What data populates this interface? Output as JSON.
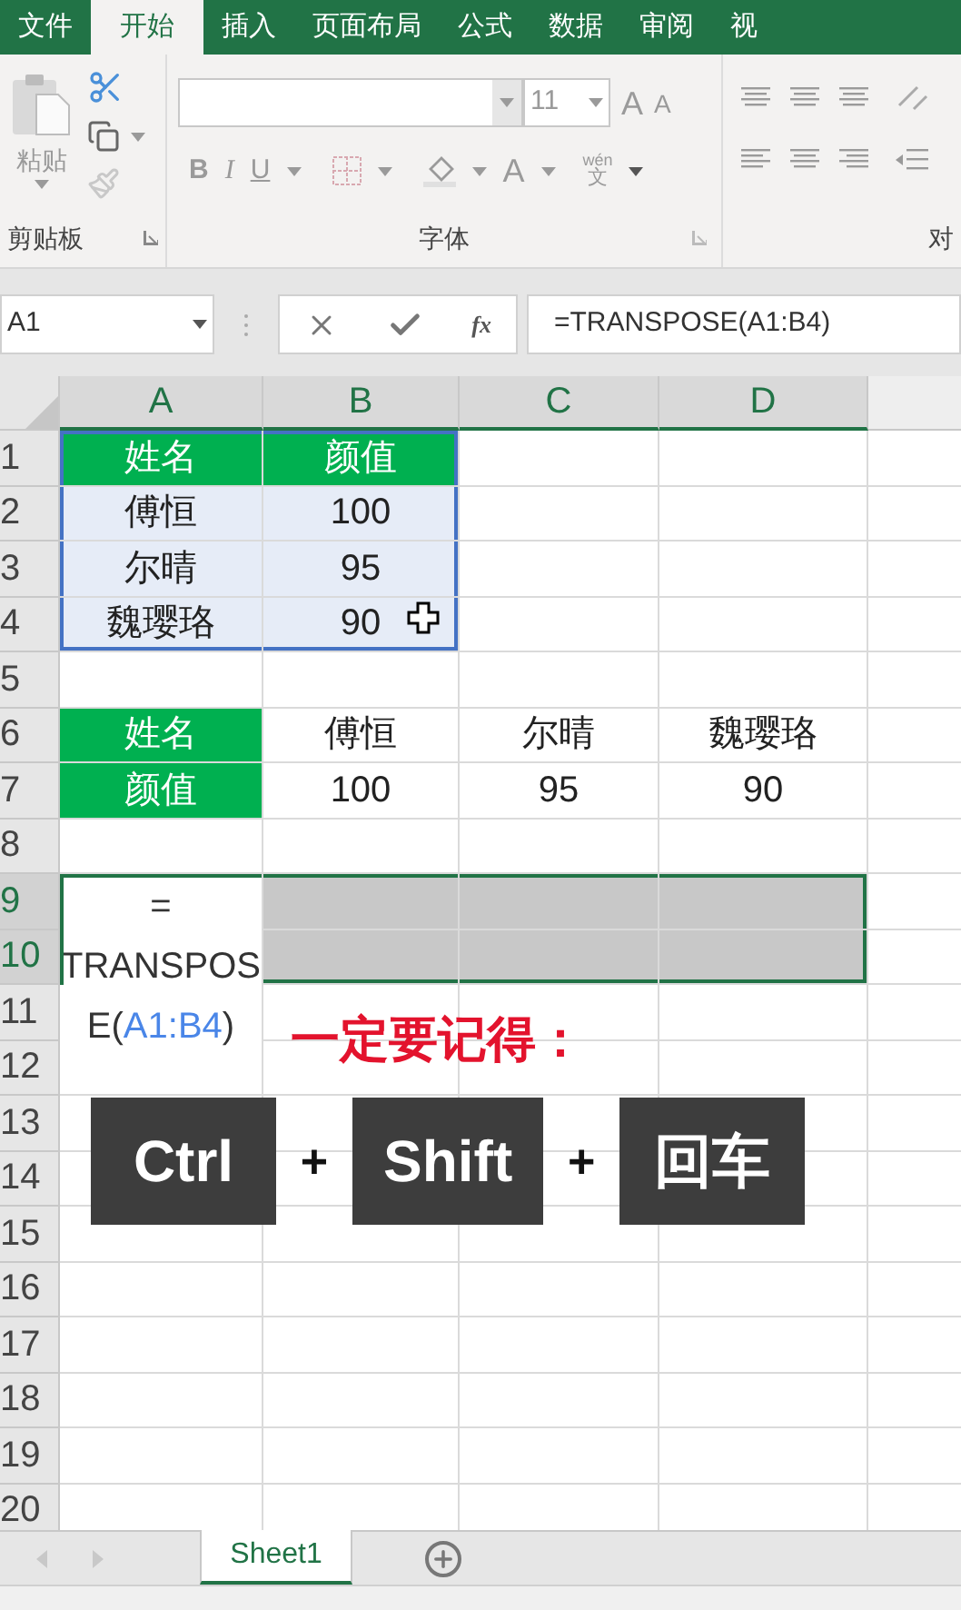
{
  "ribbon_tabs": [
    {
      "label": "文件",
      "selected": false
    },
    {
      "label": "开始",
      "selected": true
    },
    {
      "label": "插入",
      "selected": false
    },
    {
      "label": "页面布局",
      "selected": false
    },
    {
      "label": "公式",
      "selected": false
    },
    {
      "label": "数据",
      "selected": false
    },
    {
      "label": "审阅",
      "selected": false
    },
    {
      "label": "视",
      "selected": false
    }
  ],
  "ribbon": {
    "paste_label": "粘贴",
    "font_size": "11",
    "grow_font": "A",
    "shrink_font": "A",
    "bold": "B",
    "italic": "I",
    "underline": "U",
    "font_color": "A",
    "phonetic_top": "wén",
    "phonetic_bottom": "文",
    "group_labels": [
      "剪贴板",
      "字体",
      "对"
    ]
  },
  "formula_bar": {
    "name_box": "A1",
    "function_label": "fx",
    "formula": "=TRANSPOSE(A1:B4)"
  },
  "columns": [
    "A",
    "B",
    "C",
    "D"
  ],
  "rows": [
    {
      "number": "1",
      "cells": [
        {
          "kind": "header",
          "text": "姓名",
          "selected": false,
          "referenced": true
        },
        {
          "kind": "header",
          "text": "颜值",
          "selected": false,
          "referenced": true
        },
        {
          "kind": "blank",
          "selected": false,
          "referenced": false
        },
        {
          "kind": "blank",
          "selected": false,
          "referenced": false
        }
      ]
    },
    {
      "number": "2",
      "cells": [
        {
          "kind": "text",
          "text": "傅恒",
          "selected": false,
          "referenced": true
        },
        {
          "kind": "text",
          "text": "100",
          "selected": false,
          "referenced": true
        },
        {
          "kind": "blank",
          "selected": false,
          "referenced": false
        },
        {
          "kind": "blank",
          "selected": false,
          "referenced": false
        }
      ]
    },
    {
      "number": "3",
      "cells": [
        {
          "kind": "text",
          "text": "尔晴",
          "selected": false,
          "referenced": true
        },
        {
          "kind": "text",
          "text": "95",
          "selected": false,
          "referenced": true
        },
        {
          "kind": "blank",
          "selected": false,
          "referenced": false
        },
        {
          "kind": "blank",
          "selected": false,
          "referenced": false
        }
      ]
    },
    {
      "number": "4",
      "cells": [
        {
          "kind": "text",
          "text": "魏璎珞",
          "selected": false,
          "referenced": true
        },
        {
          "kind": "text",
          "text": "90",
          "selected": false,
          "referenced": true
        },
        {
          "kind": "blank",
          "selected": false,
          "referenced": false
        },
        {
          "kind": "blank",
          "selected": false,
          "referenced": false
        }
      ]
    },
    {
      "number": "5",
      "cells": [
        {
          "kind": "blank",
          "selected": false,
          "referenced": false
        },
        {
          "kind": "blank",
          "selected": false,
          "referenced": false
        },
        {
          "kind": "blank",
          "selected": false,
          "referenced": false
        },
        {
          "kind": "blank",
          "selected": false,
          "referenced": false
        }
      ]
    },
    {
      "number": "6",
      "cells": [
        {
          "kind": "header",
          "text": "姓名",
          "selected": false,
          "referenced": false
        },
        {
          "kind": "text",
          "text": "傅恒",
          "selected": false,
          "referenced": false
        },
        {
          "kind": "text",
          "text": "尔晴",
          "selected": false,
          "referenced": false
        },
        {
          "kind": "text",
          "text": "魏璎珞",
          "selected": false,
          "referenced": false
        }
      ]
    },
    {
      "number": "7",
      "cells": [
        {
          "kind": "header",
          "text": "颜值",
          "selected": false,
          "referenced": false
        },
        {
          "kind": "text",
          "text": "100",
          "selected": false,
          "referenced": false
        },
        {
          "kind": "text",
          "text": "95",
          "selected": false,
          "referenced": false
        },
        {
          "kind": "text",
          "text": "90",
          "selected": false,
          "referenced": false
        }
      ]
    },
    {
      "number": "8",
      "cells": [
        {
          "kind": "blank",
          "selected": false,
          "referenced": false
        },
        {
          "kind": "blank",
          "selected": false,
          "referenced": false
        },
        {
          "kind": "blank",
          "selected": false,
          "referenced": false
        },
        {
          "kind": "blank",
          "selected": false,
          "referenced": false
        }
      ]
    },
    {
      "number": "9",
      "cells": [
        {
          "kind": "formula",
          "lines": [
            [
              {
                "text": "="
              }
            ],
            [
              {
                "text": "TRANSPOS"
              }
            ],
            [
              {
                "text": "E("
              },
              {
                "text": "A1:B4",
                "kind": "ref"
              },
              {
                "text": ")"
              }
            ]
          ],
          "selected": true,
          "referenced": false
        },
        {
          "kind": "blank",
          "selected": true,
          "referenced": false
        },
        {
          "kind": "blank",
          "selected": true,
          "referenced": false
        },
        {
          "kind": "blank",
          "selected": true,
          "referenced": false
        }
      ]
    },
    {
      "number": "10",
      "cells": [
        {
          "kind": "blank",
          "selected": true,
          "referenced": false
        },
        {
          "kind": "blank",
          "selected": true,
          "referenced": false
        },
        {
          "kind": "blank",
          "selected": true,
          "referenced": false
        }
      ]
    },
    {
      "number": "11",
      "cells": [
        {
          "kind": "blank",
          "selected": false,
          "referenced": false
        },
        {
          "kind": "blank",
          "selected": false,
          "referenced": false
        },
        {
          "kind": "blank",
          "selected": false,
          "referenced": false
        }
      ]
    },
    {
      "number": "12",
      "cells": [
        {
          "kind": "blank",
          "selected": false,
          "referenced": false
        },
        {
          "kind": "blank",
          "selected": false,
          "referenced": false
        },
        {
          "kind": "blank",
          "selected": false,
          "referenced": false
        },
        {
          "kind": "blank",
          "selected": false,
          "referenced": false
        }
      ]
    },
    {
      "number": "13",
      "cells": [
        {
          "kind": "blank",
          "selected": false,
          "referenced": false
        },
        {
          "kind": "blank",
          "selected": false,
          "referenced": false
        },
        {
          "kind": "blank",
          "selected": false,
          "referenced": false
        },
        {
          "kind": "blank",
          "selected": false,
          "referenced": false
        }
      ]
    },
    {
      "number": "14",
      "cells": [
        {
          "kind": "blank",
          "selected": false,
          "referenced": false
        },
        {
          "kind": "blank",
          "selected": false,
          "referenced": false
        },
        {
          "kind": "blank",
          "selected": false,
          "referenced": false
        },
        {
          "kind": "blank",
          "selected": false,
          "referenced": false
        }
      ]
    },
    {
      "number": "15",
      "cells": [
        {
          "kind": "blank",
          "selected": false,
          "referenced": false
        },
        {
          "kind": "blank",
          "selected": false,
          "referenced": false
        },
        {
          "kind": "blank",
          "selected": false,
          "referenced": false
        },
        {
          "kind": "blank",
          "selected": false,
          "referenced": false
        }
      ]
    },
    {
      "number": "16",
      "cells": [
        {
          "kind": "blank",
          "selected": false,
          "referenced": false
        },
        {
          "kind": "blank",
          "selected": false,
          "referenced": false
        },
        {
          "kind": "blank",
          "selected": false,
          "referenced": false
        },
        {
          "kind": "blank",
          "selected": false,
          "referenced": false
        }
      ]
    },
    {
      "number": "17",
      "cells": [
        {
          "kind": "blank",
          "selected": false,
          "referenced": false
        },
        {
          "kind": "blank",
          "selected": false,
          "referenced": false
        },
        {
          "kind": "blank",
          "selected": false,
          "referenced": false
        },
        {
          "kind": "blank",
          "selected": false,
          "referenced": false
        }
      ]
    },
    {
      "number": "18",
      "cells": [
        {
          "kind": "blank",
          "selected": false,
          "referenced": false
        },
        {
          "kind": "blank",
          "selected": false,
          "referenced": false
        },
        {
          "kind": "blank",
          "selected": false,
          "referenced": false
        },
        {
          "kind": "blank",
          "selected": false,
          "referenced": false
        }
      ]
    },
    {
      "number": "19",
      "cells": [
        {
          "kind": "blank",
          "selected": false,
          "referenced": false
        },
        {
          "kind": "blank",
          "selected": false,
          "referenced": false
        },
        {
          "kind": "blank",
          "selected": false,
          "referenced": false
        },
        {
          "kind": "blank",
          "selected": false,
          "referenced": false
        }
      ]
    },
    {
      "number": "20",
      "cells": [
        {
          "kind": "blank",
          "selected": false,
          "referenced": false
        },
        {
          "kind": "blank",
          "selected": false,
          "referenced": false
        },
        {
          "kind": "blank",
          "selected": false,
          "referenced": false
        },
        {
          "kind": "blank",
          "selected": false,
          "referenced": false
        }
      ]
    }
  ],
  "overlay": {
    "reminder": "一定要记得：",
    "keys": [
      "Ctrl",
      "Shift",
      "回车"
    ],
    "plus_signs": [
      "+",
      "+"
    ]
  },
  "sheet_tabs": [
    {
      "label": "Sheet1",
      "selected": true
    }
  ]
}
